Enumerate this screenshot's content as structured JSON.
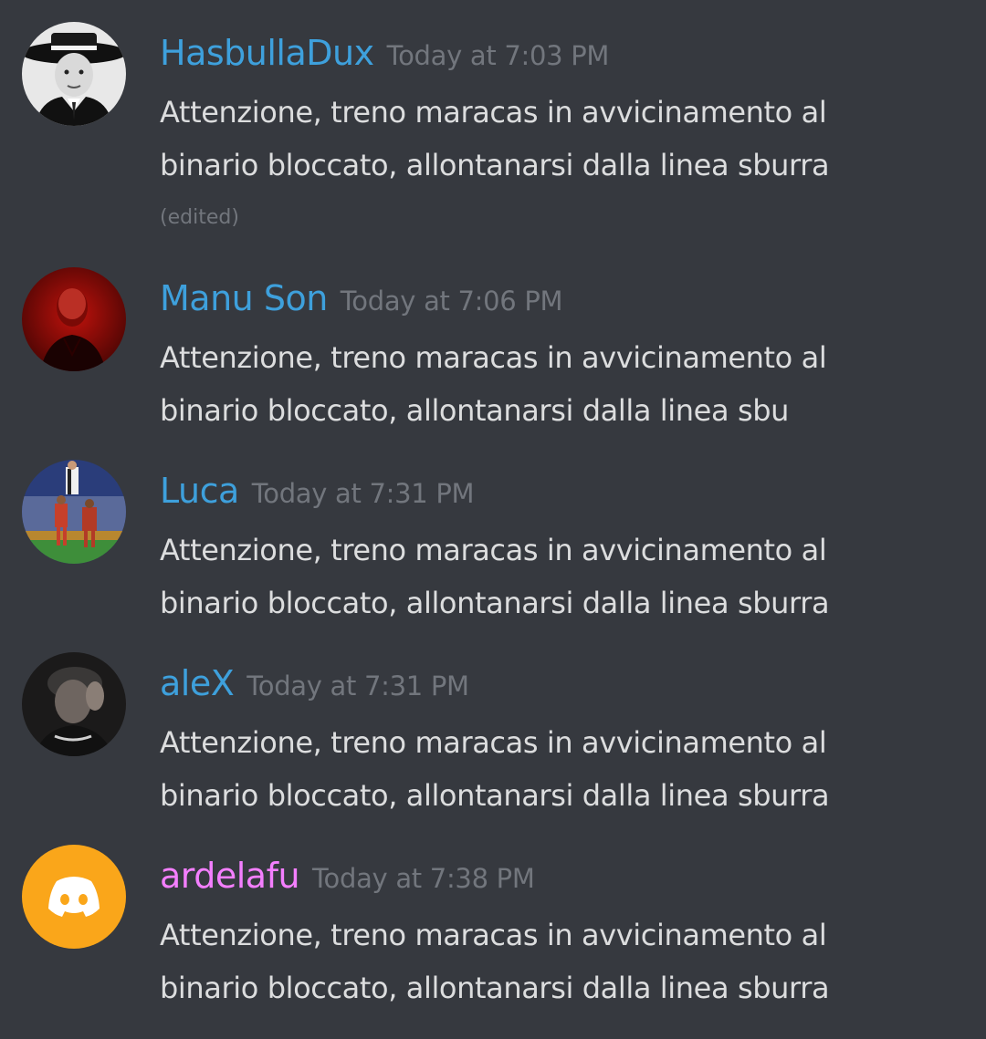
{
  "colors": {
    "background": "#36393f",
    "message_text": "#dcddde",
    "timestamp": "#72767d",
    "username_blue": "#3ea0dc",
    "username_pink": "#f47fff",
    "discord_avatar_bg": "#faa61a"
  },
  "messages": [
    {
      "username": "HasbullaDux",
      "timestamp": "Today at 7:03 PM",
      "line1": "Attenzione, treno maracas in avvicinamento al",
      "line2": "binario bloccato, allontanarsi dalla linea sburra",
      "edited": "(edited)",
      "avatar": "man-in-hat-avatar"
    },
    {
      "username": "Manu Son",
      "timestamp": "Today at 7:06 PM",
      "line1": "Attenzione, treno maracas in avvicinamento al",
      "line2": "binario bloccato, allontanarsi dalla linea sbu",
      "avatar": "red-portrait-avatar"
    },
    {
      "username": "Luca",
      "timestamp": "Today at 7:31 PM",
      "line1": "Attenzione, treno maracas in avvicinamento al",
      "line2": "binario bloccato, allontanarsi dalla linea sburra",
      "avatar": "football-players-avatar"
    },
    {
      "username": "aleX",
      "timestamp": "Today at 7:31 PM",
      "line1": "Attenzione, treno maracas in avvicinamento al",
      "line2": "binario bloccato, allontanarsi dalla linea sburra",
      "avatar": "dark-portrait-avatar"
    },
    {
      "username": "ardelafu",
      "timestamp": "Today at 7:38 PM",
      "line1": "Attenzione, treno maracas in avvicinamento al",
      "line2": "binario bloccato, allontanarsi dalla linea sburra",
      "avatar": "discord-logo-icon"
    }
  ]
}
